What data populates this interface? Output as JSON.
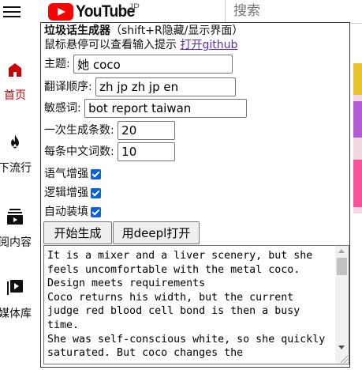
{
  "topbar": {
    "logo_text": "YouTube",
    "logo_country": "JP",
    "search_placeholder": "搜索"
  },
  "sidebar": {
    "items": [
      {
        "label": "首页",
        "icon": "home-icon",
        "active": true
      },
      {
        "label": "下流行",
        "icon": "flame-icon",
        "active": false
      },
      {
        "label": "阅内容",
        "icon": "subscriptions-icon",
        "active": false
      },
      {
        "label": "媒体库",
        "icon": "library-icon",
        "active": false
      }
    ]
  },
  "panel": {
    "title": "垃圾话生成器",
    "title_suffix": "（shift+R隐藏/显示界面）",
    "hint_text": "鼠标悬停可以查看输入提示 ",
    "github_link": "打开github",
    "topic_label": "主题:",
    "topic_value": "她 coco",
    "order_label": "翻译顺序:",
    "order_value": "zh jp zh jp en",
    "sensitive_label": "敏感词:",
    "sensitive_value": "bot report taiwan",
    "count_label": "一次生成条数:",
    "count_value": "20",
    "words_label": "每条中文词数:",
    "words_value": "10",
    "tone_label": "语气增强",
    "logic_label": "逻辑增强",
    "autofill_label": "自动装填",
    "start_button": "开始生成",
    "deepl_button": "用deepl打开",
    "output_text": "It is a mixer and a liver scenery, but she feels uncomfortable with the metal coco. Design meets requirements\nCoco returns his width, but the current judge red blood cell bond is then a busy time.\nShe was self-conscious white, so she quickly saturated. But coco changes the"
  },
  "colors": {
    "brand_red": "#ff0000",
    "checkbox_blue": "#0a64d6",
    "link_purple": "#5b2bb5"
  }
}
